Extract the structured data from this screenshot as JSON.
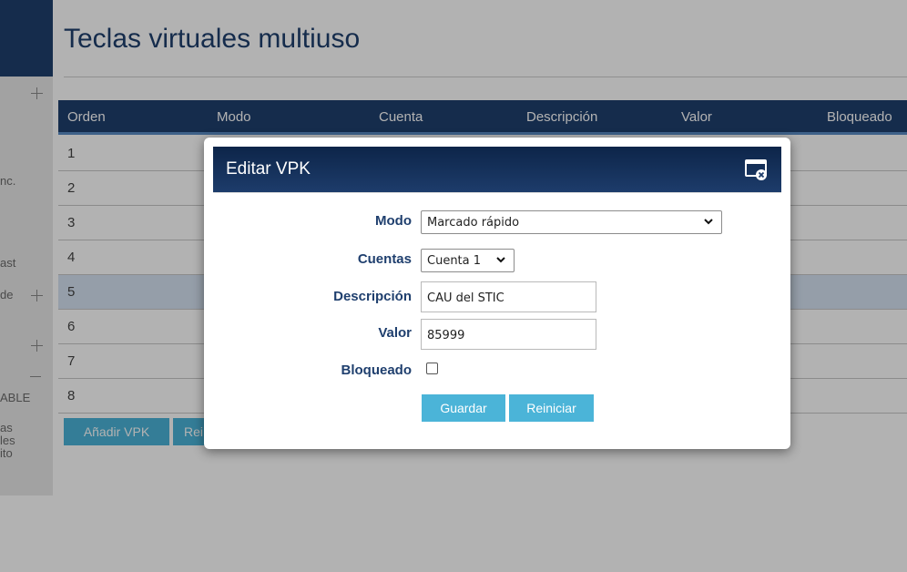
{
  "page": {
    "title": "Teclas virtuales multiuso",
    "sidebar": {
      "texts": [
        "nc.",
        "ast",
        "de",
        "ABLE",
        "as",
        "les",
        "ito"
      ]
    },
    "table": {
      "headers": [
        "Orden",
        "Modo",
        "Cuenta",
        "Descripción",
        "Valor",
        "Bloqueado"
      ],
      "rows": [
        "1",
        "2",
        "3",
        "4",
        "5",
        "6",
        "7",
        "8"
      ],
      "selected_row": "5"
    },
    "buttons": {
      "add": "Añadir VPK",
      "partial": "Rei"
    }
  },
  "modal": {
    "title": "Editar VPK",
    "fields": {
      "modo_label": "Modo",
      "modo_value": "Marcado rápido",
      "cuentas_label": "Cuentas",
      "cuentas_value": "Cuenta 1",
      "descripcion_label": "Descripción",
      "descripcion_value": "CAU del STIC",
      "valor_label": "Valor",
      "valor_value": "85999",
      "bloqueado_label": "Bloqueado",
      "bloqueado_checked": false
    },
    "buttons": {
      "save": "Guardar",
      "reset": "Reiniciar"
    }
  },
  "colors": {
    "primary_dark": "#1f3f6e",
    "accent_button": "#4bb4d8",
    "selected_row": "#d6e2f3"
  }
}
